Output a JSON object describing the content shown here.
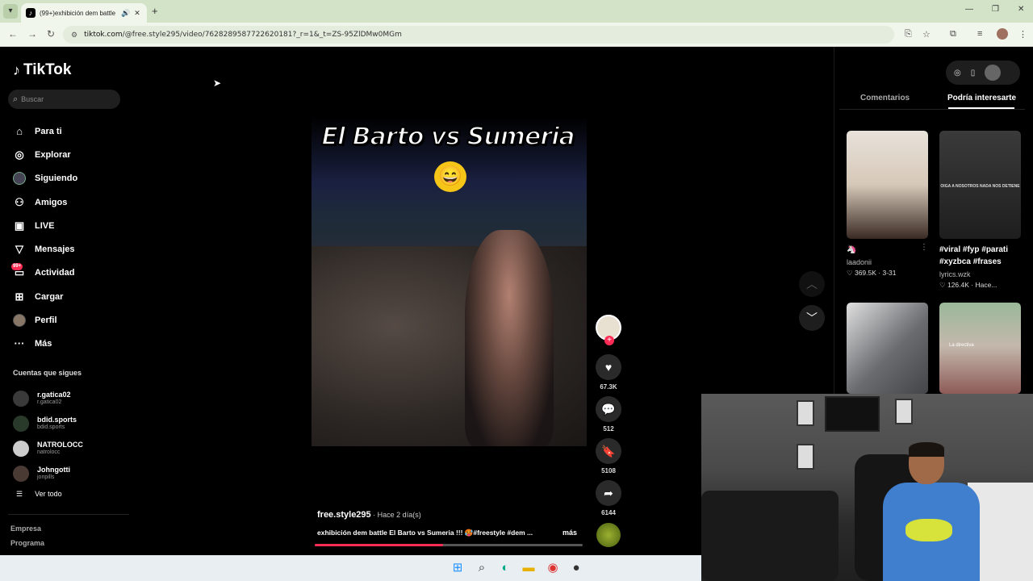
{
  "browser": {
    "tab_title": "(99+)exhibición dem battle",
    "url_domain": "tiktok.com",
    "url_path": "/@free.style295/video/7628289587722620181?_r=1&_t=ZS-95ZlDMw0MGm",
    "new_tab_symbol": "+"
  },
  "brand": {
    "name": "TikTok"
  },
  "search": {
    "placeholder": "Buscar"
  },
  "nav": [
    {
      "label": "Para ti",
      "icon": "home-icon"
    },
    {
      "label": "Explorar",
      "icon": "compass-icon"
    },
    {
      "label": "Siguiendo",
      "icon": "following-avatar-icon"
    },
    {
      "label": "Amigos",
      "icon": "friends-icon"
    },
    {
      "label": "LIVE",
      "icon": "live-icon"
    },
    {
      "label": "Mensajes",
      "icon": "messages-icon"
    },
    {
      "label": "Actividad",
      "icon": "activity-icon",
      "badge": "99+"
    },
    {
      "label": "Cargar",
      "icon": "upload-icon"
    },
    {
      "label": "Perfil",
      "icon": "profile-avatar-icon"
    },
    {
      "label": "Más",
      "icon": "more-icon"
    }
  ],
  "following": {
    "title": "Cuentas que sigues",
    "accounts": [
      {
        "name": "r.gatica02",
        "handle": "r.gatica02"
      },
      {
        "name": "bdid.sports",
        "handle": "bdid.sports"
      },
      {
        "name": "NATROLOCC",
        "handle": "natrolocc"
      },
      {
        "name": "Johngotti",
        "handle": "jonpills"
      }
    ],
    "see_all": "Ver todo"
  },
  "footer": {
    "company": "Empresa",
    "program": "Programa"
  },
  "video": {
    "overlay_title": "El Barto vs Sumeria",
    "emoji": "😄",
    "author": "free.style295",
    "age": " · Hace 2 día(s)",
    "caption": "exhibición dem battle El Barto vs Sumeria !!! 🥵#freestyle #dem ...",
    "more_label": "más",
    "progress": 0.48
  },
  "actions": {
    "likes": "67.3K",
    "comments": "512",
    "saves": "5108",
    "shares": "6144"
  },
  "right_panel": {
    "tab_comments": "Comentarios",
    "tab_suggested": "Podría interesarte",
    "items": [
      {
        "desc": "🦄",
        "user": "laadonii",
        "stats": "♡ 369.5K · 3-31",
        "color": "#d8cfc6"
      },
      {
        "desc": "#viral #fyp #parati #xyzbca #frases",
        "user": "lyrics.wzk",
        "stats": "♡ 126.4K · Hace...",
        "overlay": "OIGA A NOSOTROS NADA NOS DETIENE",
        "color": "#2a2a2a"
      },
      {
        "color": "#8d8f92"
      },
      {
        "overlay": "La directiva",
        "color": "#b8b0a8"
      }
    ]
  },
  "colors": {
    "accent": "#fe2c55",
    "bg": "#000000"
  }
}
